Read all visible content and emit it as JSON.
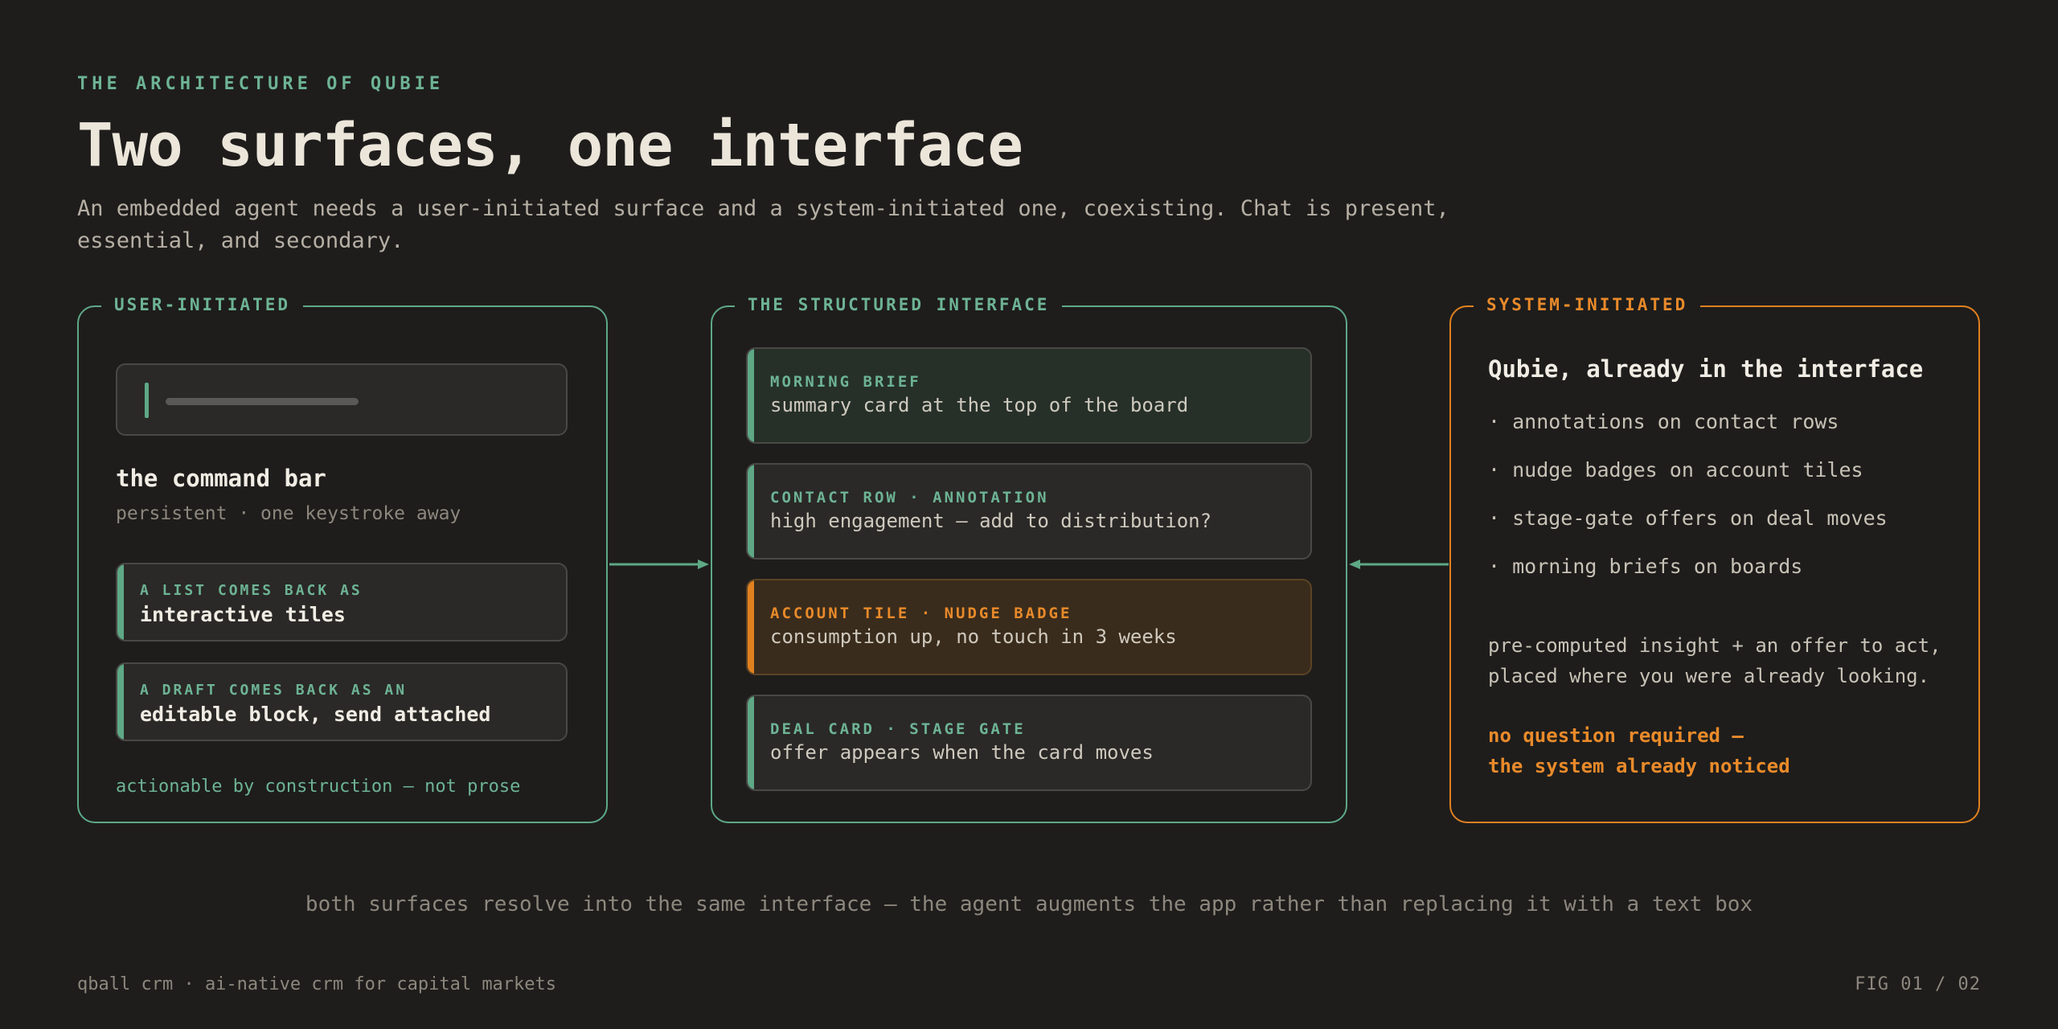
{
  "header": {
    "eyebrow": "THE ARCHITECTURE OF QUBIE",
    "title": "Two surfaces, one interface",
    "subtitle": "An embedded agent needs a user-initiated surface and a system-initiated one, coexisting. Chat is present, essential, and secondary."
  },
  "user_panel": {
    "label": "USER-INITIATED",
    "command_bar_title": "the command bar",
    "command_bar_sub": "persistent · one keystroke away",
    "tiles": [
      {
        "eyebrow": "A LIST COMES BACK AS",
        "text": "interactive tiles"
      },
      {
        "eyebrow": "A DRAFT COMES BACK AS AN",
        "text": "editable block, send attached"
      }
    ],
    "footer": "actionable by construction — not prose"
  },
  "middle_panel": {
    "label": "THE STRUCTURED INTERFACE",
    "cards": [
      {
        "eyebrow": "MORNING BRIEF",
        "text": "summary card at the top of the board",
        "variant": "brief"
      },
      {
        "eyebrow": "CONTACT ROW · ANNOTATION",
        "text": "high engagement — add to distribution?",
        "variant": "default"
      },
      {
        "eyebrow": "ACCOUNT TILE · NUDGE BADGE",
        "text": "consumption up, no touch in 3 weeks",
        "variant": "nudge"
      },
      {
        "eyebrow": "DEAL CARD · STAGE GATE",
        "text": "offer appears when the card moves",
        "variant": "default"
      }
    ]
  },
  "system_panel": {
    "label": "SYSTEM-INITIATED",
    "title": "Qubie, already in the interface",
    "items": [
      "· annotations on contact rows",
      "· nudge badges on account tiles",
      "· stage-gate offers on deal moves",
      "· morning briefs on boards"
    ],
    "body": "pre-computed insight + an offer to act, placed where you were already looking.",
    "accent_line1": "no question required —",
    "accent_line2": "the system already noticed"
  },
  "footer": {
    "caption": "both surfaces resolve into the same interface — the agent augments the app rather than replacing it with a text box",
    "brand": "qball crm · ai-native crm for capital markets",
    "figure": "FIG 01 / 02"
  },
  "colors": {
    "background": "#1e1d1c",
    "green_accent": "#5ea886",
    "orange_accent": "#e0801f",
    "text_primary": "#ece6da",
    "text_muted": "#8d877d"
  }
}
